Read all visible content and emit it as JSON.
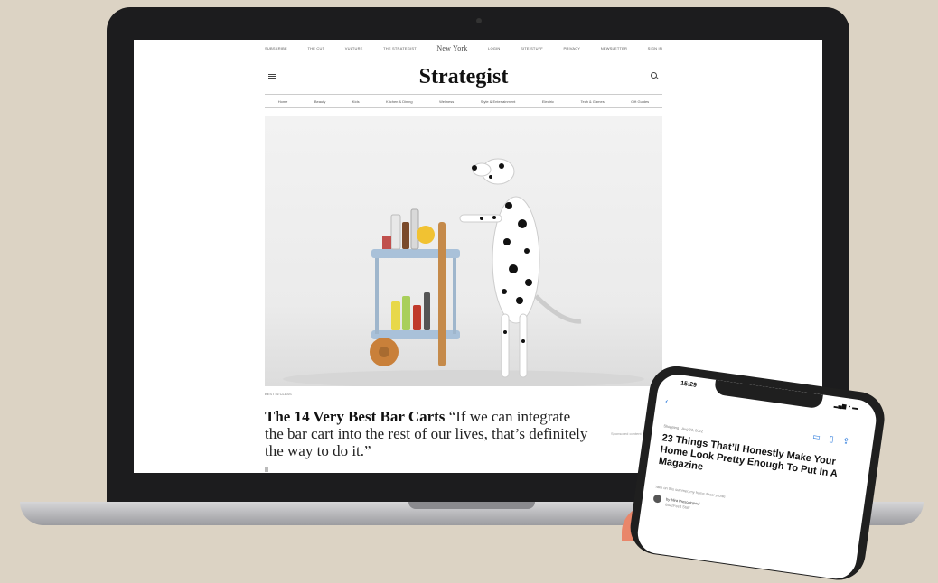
{
  "site": {
    "topbar_items": [
      "SUBSCRIBE",
      "THE CUT",
      "VULTURE",
      "THE STRATEGIST",
      "LOGIN",
      "SITE STUFF",
      "PRIVACY",
      "NEWSLETTER",
      "SIGN IN"
    ],
    "topbar_logo": "New York",
    "logo": "Strategist",
    "nav_items": [
      "Home",
      "Beauty",
      "Kids",
      "Kitchen & Dining",
      "Wellness",
      "Style & Entertainment",
      "Electric",
      "Tech & Games",
      "Gift Guides"
    ],
    "hero_caption": "BEST IN CLASS",
    "headline_bold": "The 14 Very Best Bar Carts",
    "headline_quote": " “If we can integrate the bar cart into the rest of our lives, that’s definitely the way to do it.”",
    "sidebar_text": "Sponsored content"
  },
  "phone": {
    "time": "15:29",
    "status": "▂▄▆ ◔ ▬",
    "back": "‹",
    "tag": "Shopping · Aug 03, 2022",
    "title": "23 Things That’ll Honestly Make Your Home Look Pretty Enough To Put In A Magazine",
    "dek": "Take on this summer, my home decor profile",
    "byline": "by Mira Prescotopoul",
    "role": "BuzzFeed Staff"
  },
  "colors": {
    "background": "#dcd3c4",
    "laptop_frame": "#1c1c1e",
    "link_blue": "#1a6fd9"
  }
}
